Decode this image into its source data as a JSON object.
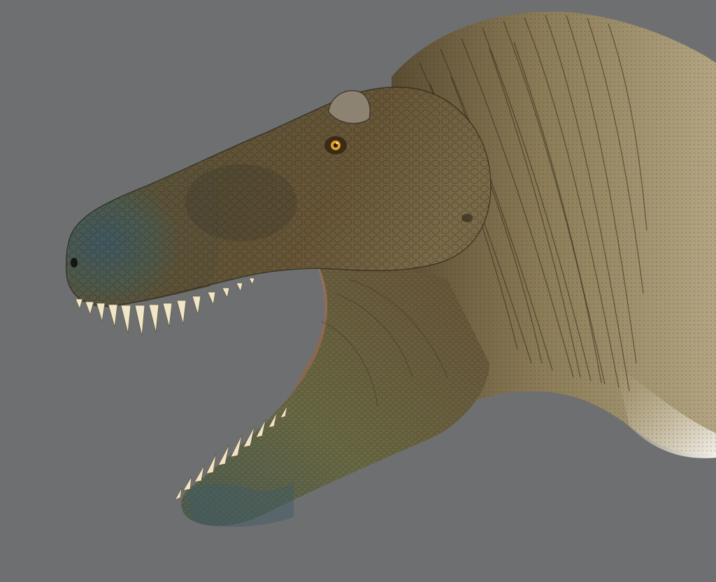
{
  "scene": {
    "background_color": "#6e6f71",
    "subject": "dinosaur-head-illustration",
    "palette": {
      "snout_blue": "#3f5763",
      "head_brown": "#6b5a3c",
      "neck_tan": "#a89670",
      "feather_dark": "#4e4430",
      "mouth_pink": "#9a6e64",
      "teeth": "#f0e6c8",
      "eye": "#e0a020",
      "belly_white": "#f2f0ea"
    }
  }
}
